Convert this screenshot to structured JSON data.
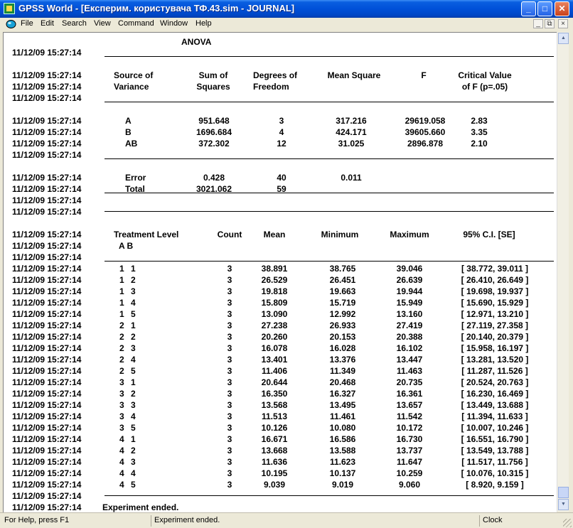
{
  "window": {
    "title": "GPSS World - [Експерим. користувача ТФ.43.sim  -  JOURNAL]"
  },
  "menu": [
    "File",
    "Edit",
    "Search",
    "View",
    "Command",
    "Window",
    "Help"
  ],
  "mdi_controls": [
    "_",
    "⧉",
    "×"
  ],
  "journal": {
    "timestamp": "11/12/09 15:27:14",
    "anova_title": "ANOVA",
    "anova_headers": {
      "source": [
        "Source of",
        "Variance"
      ],
      "ss": [
        "Sum of",
        "Squares"
      ],
      "df": [
        "Degrees of",
        "Freedom"
      ],
      "ms": "Mean Square",
      "f": "F",
      "crit": [
        "Critical Value",
        "of F (p=.05)"
      ]
    },
    "anova_rows": [
      {
        "source": "A",
        "ss": "951.648",
        "df": "3",
        "ms": "317.216",
        "f": "29619.058",
        "crit": "2.83"
      },
      {
        "source": "B",
        "ss": "1696.684",
        "df": "4",
        "ms": "424.171",
        "f": "39605.660",
        "crit": "3.35"
      },
      {
        "source": "AB",
        "ss": "372.302",
        "df": "12",
        "ms": "31.025",
        "f": "2896.878",
        "crit": "2.10"
      }
    ],
    "error_row": {
      "source": "Error",
      "ss": "0.428",
      "df": "40",
      "ms": "0.011"
    },
    "total_row": {
      "source": "Total",
      "ss": "3021.062",
      "df": "59"
    },
    "treatment_headers": {
      "level": "Treatment Level",
      "level_sub": "A  B",
      "count": "Count",
      "mean": "Mean",
      "min": "Minimum",
      "max": "Maximum",
      "ci": "95% C.I. [SE]"
    },
    "treatment_rows": [
      {
        "a": "1",
        "b": "1",
        "count": "3",
        "mean": "38.891",
        "min": "38.765",
        "max": "39.046",
        "ci": "[ 38.772, 39.011 ]"
      },
      {
        "a": "1",
        "b": "2",
        "count": "3",
        "mean": "26.529",
        "min": "26.451",
        "max": "26.639",
        "ci": "[ 26.410, 26.649 ]"
      },
      {
        "a": "1",
        "b": "3",
        "count": "3",
        "mean": "19.818",
        "min": "19.663",
        "max": "19.944",
        "ci": "[ 19.698, 19.937 ]"
      },
      {
        "a": "1",
        "b": "4",
        "count": "3",
        "mean": "15.809",
        "min": "15.719",
        "max": "15.949",
        "ci": "[ 15.690, 15.929 ]"
      },
      {
        "a": "1",
        "b": "5",
        "count": "3",
        "mean": "13.090",
        "min": "12.992",
        "max": "13.160",
        "ci": "[ 12.971, 13.210 ]"
      },
      {
        "a": "2",
        "b": "1",
        "count": "3",
        "mean": "27.238",
        "min": "26.933",
        "max": "27.419",
        "ci": "[ 27.119, 27.358 ]"
      },
      {
        "a": "2",
        "b": "2",
        "count": "3",
        "mean": "20.260",
        "min": "20.153",
        "max": "20.388",
        "ci": "[ 20.140, 20.379 ]"
      },
      {
        "a": "2",
        "b": "3",
        "count": "3",
        "mean": "16.078",
        "min": "16.028",
        "max": "16.102",
        "ci": "[ 15.958, 16.197 ]"
      },
      {
        "a": "2",
        "b": "4",
        "count": "3",
        "mean": "13.401",
        "min": "13.376",
        "max": "13.447",
        "ci": "[ 13.281, 13.520 ]"
      },
      {
        "a": "2",
        "b": "5",
        "count": "3",
        "mean": "11.406",
        "min": "11.349",
        "max": "11.463",
        "ci": "[ 11.287, 11.526 ]"
      },
      {
        "a": "3",
        "b": "1",
        "count": "3",
        "mean": "20.644",
        "min": "20.468",
        "max": "20.735",
        "ci": "[ 20.524, 20.763 ]"
      },
      {
        "a": "3",
        "b": "2",
        "count": "3",
        "mean": "16.350",
        "min": "16.327",
        "max": "16.361",
        "ci": "[ 16.230, 16.469 ]"
      },
      {
        "a": "3",
        "b": "3",
        "count": "3",
        "mean": "13.568",
        "min": "13.495",
        "max": "13.657",
        "ci": "[ 13.449, 13.688 ]"
      },
      {
        "a": "3",
        "b": "4",
        "count": "3",
        "mean": "11.513",
        "min": "11.461",
        "max": "11.542",
        "ci": "[ 11.394, 11.633 ]"
      },
      {
        "a": "3",
        "b": "5",
        "count": "3",
        "mean": "10.126",
        "min": "10.080",
        "max": "10.172",
        "ci": "[ 10.007, 10.246 ]"
      },
      {
        "a": "4",
        "b": "1",
        "count": "3",
        "mean": "16.671",
        "min": "16.586",
        "max": "16.730",
        "ci": "[ 16.551, 16.790 ]"
      },
      {
        "a": "4",
        "b": "2",
        "count": "3",
        "mean": "13.668",
        "min": "13.588",
        "max": "13.737",
        "ci": "[ 13.549, 13.788 ]"
      },
      {
        "a": "4",
        "b": "3",
        "count": "3",
        "mean": "11.636",
        "min": "11.623",
        "max": "11.647",
        "ci": "[ 11.517, 11.756 ]"
      },
      {
        "a": "4",
        "b": "4",
        "count": "3",
        "mean": "10.195",
        "min": "10.137",
        "max": "10.259",
        "ci": "[ 10.076, 10.315 ]"
      },
      {
        "a": "4",
        "b": "5",
        "count": "3",
        "mean": "9.039",
        "min": "9.019",
        "max": "9.060",
        "ci": "[ 8.920, 9.159 ]"
      }
    ],
    "end_message": "Experiment ended."
  },
  "status": {
    "help": "For Help, press F1",
    "message": "Experiment ended.",
    "clock": "Clock"
  },
  "colors": {
    "title_bar": "#0050d8",
    "journal_bg": "#ffffff",
    "chrome": "#ece9d8"
  }
}
